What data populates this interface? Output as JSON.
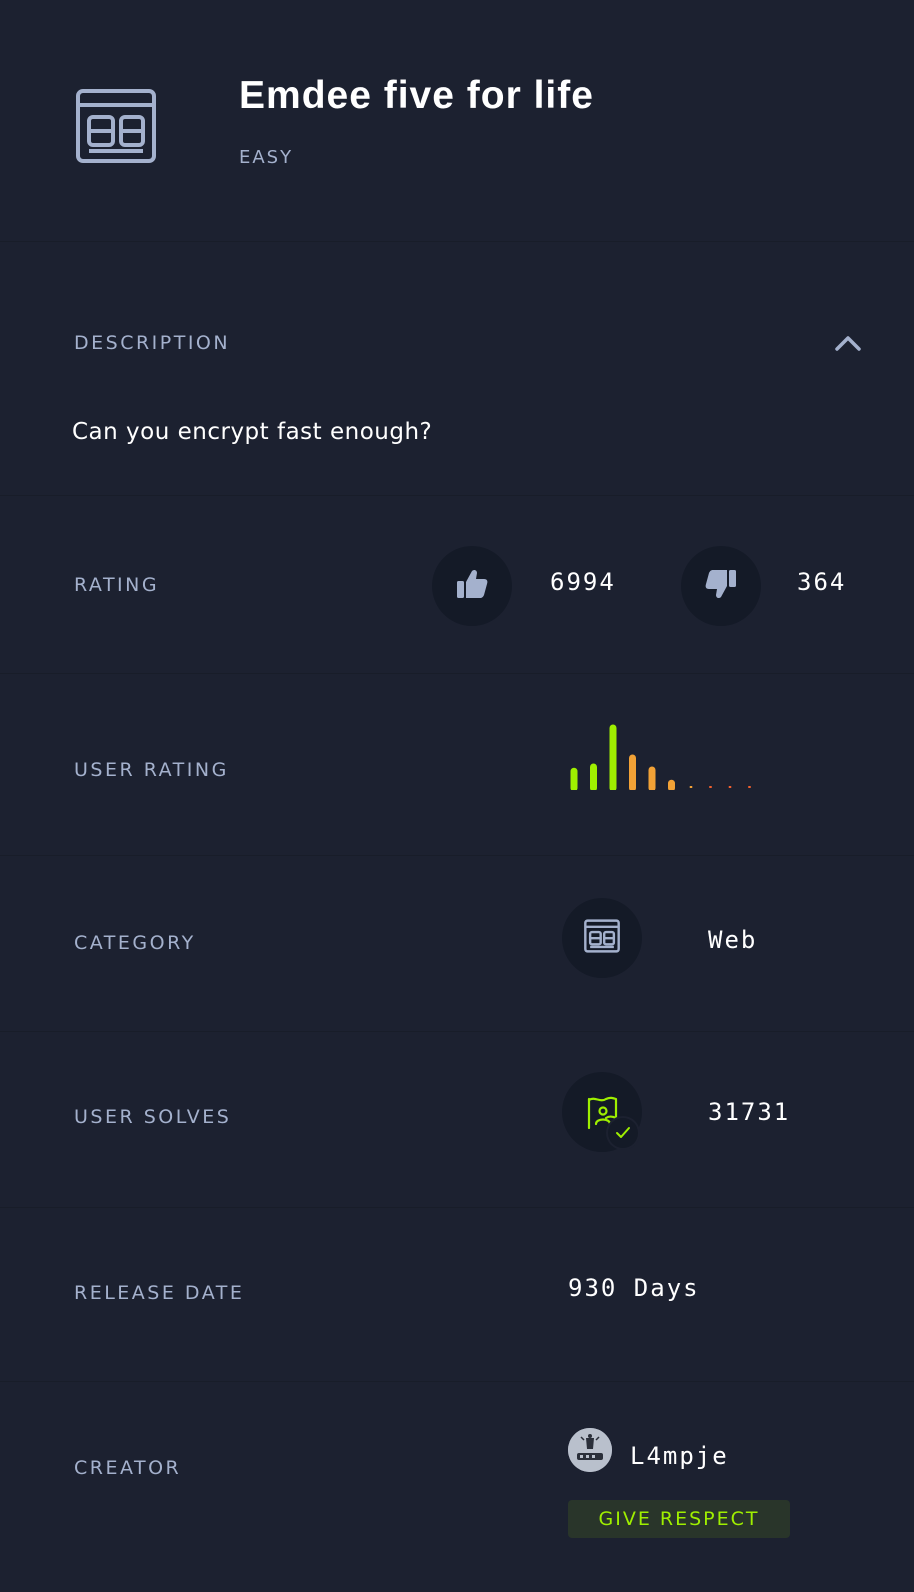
{
  "header": {
    "title": "Emdee five for life",
    "difficulty": "EASY",
    "icon": "web-browser-icon"
  },
  "description": {
    "label": "DESCRIPTION",
    "text": "Can you encrypt fast enough?",
    "toggle_icon": "chevron-up-icon"
  },
  "rating": {
    "label": "RATING",
    "likes": "6994",
    "dislikes": "364",
    "like_icon": "thumbs-up-icon",
    "dislike_icon": "thumbs-down-icon"
  },
  "user_rating": {
    "label": "USER RATING",
    "bars": [
      0.28,
      0.35,
      1.0,
      0.5,
      0.3,
      0.08,
      0.04,
      0.04,
      0.04,
      0.04
    ],
    "colors": [
      "#9fef00",
      "#9fef00",
      "#9fef00",
      "#f2a236",
      "#f2a236",
      "#f2a236",
      "#f2a236",
      "#f0602e",
      "#f0602e",
      "#f0602e"
    ]
  },
  "category": {
    "label": "CATEGORY",
    "value": "Web",
    "icon": "web-browser-icon"
  },
  "user_solves": {
    "label": "USER SOLVES",
    "value": "31731",
    "icon": "flag-user-check-icon"
  },
  "release_date": {
    "label": "RELEASE DATE",
    "value": "930 Days"
  },
  "creator": {
    "label": "CREATOR",
    "name": "L4mpje",
    "button": "GIVE RESPECT"
  },
  "colors": {
    "background": "#1c2130",
    "label": "#a4b1cd",
    "accent_green": "#9fef00",
    "circle_bg": "#141a27"
  }
}
